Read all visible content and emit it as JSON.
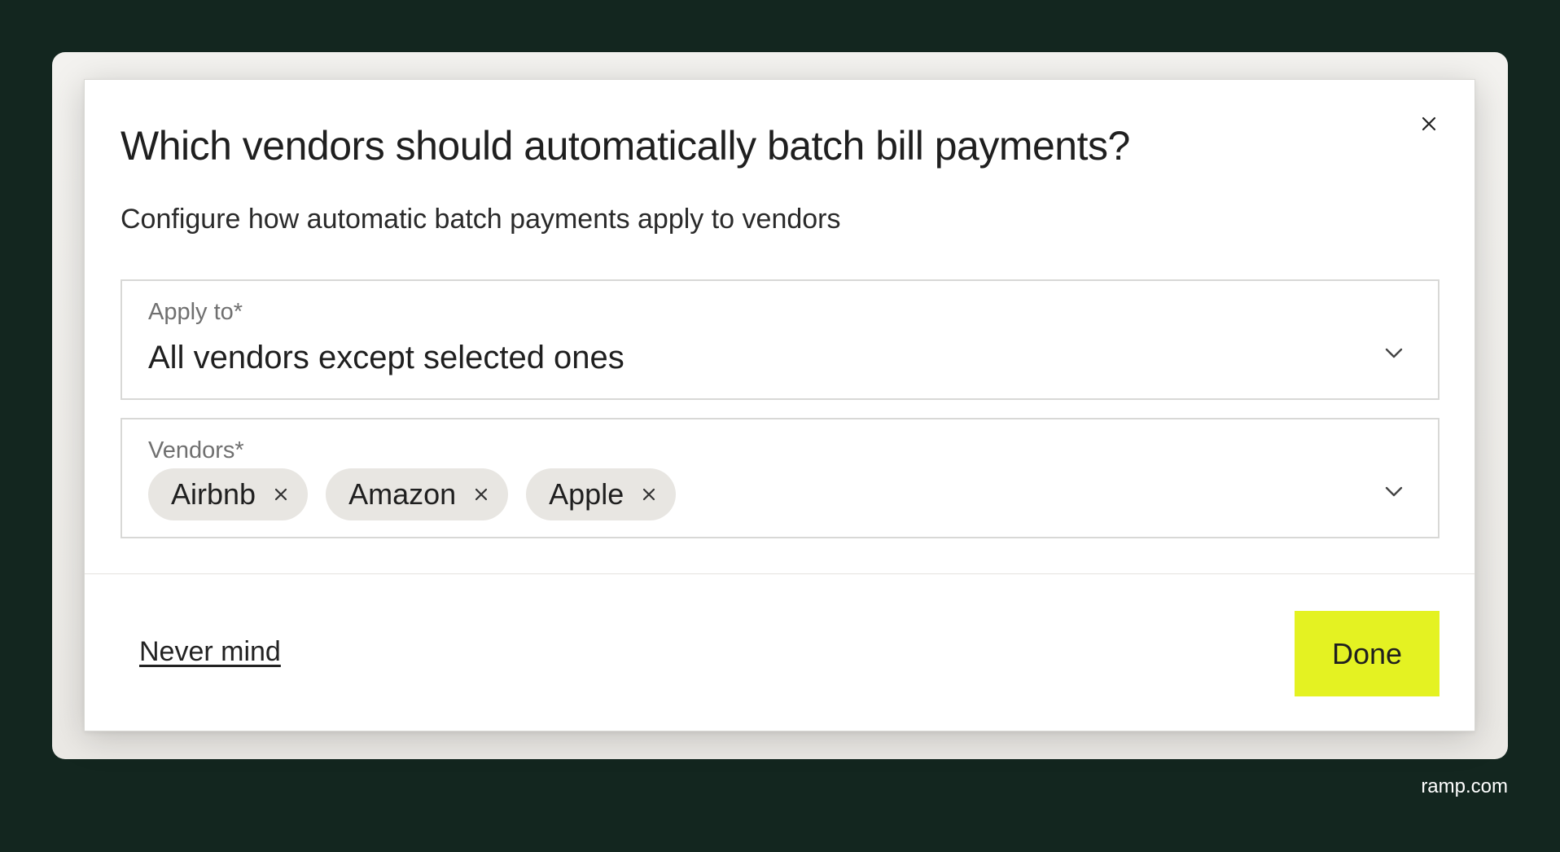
{
  "modal": {
    "title": "Which vendors should automatically batch bill payments?",
    "subtitle": "Configure how automatic batch payments apply to vendors",
    "close_icon": "close-icon"
  },
  "apply_to": {
    "label": "Apply to*",
    "value": "All vendors except selected ones",
    "icon": "chevron-down-icon"
  },
  "vendors": {
    "label": "Vendors*",
    "selected": [
      "Airbnb",
      "Amazon",
      "Apple"
    ],
    "remove_icon": "close-icon",
    "icon": "chevron-down-icon"
  },
  "footer": {
    "cancel_label": "Never mind",
    "done_label": "Done"
  },
  "brand": {
    "text": "ramp.com"
  },
  "colors": {
    "background": "#13261f",
    "primary_button": "#e4f222",
    "chip_background": "#e8e6e2"
  }
}
